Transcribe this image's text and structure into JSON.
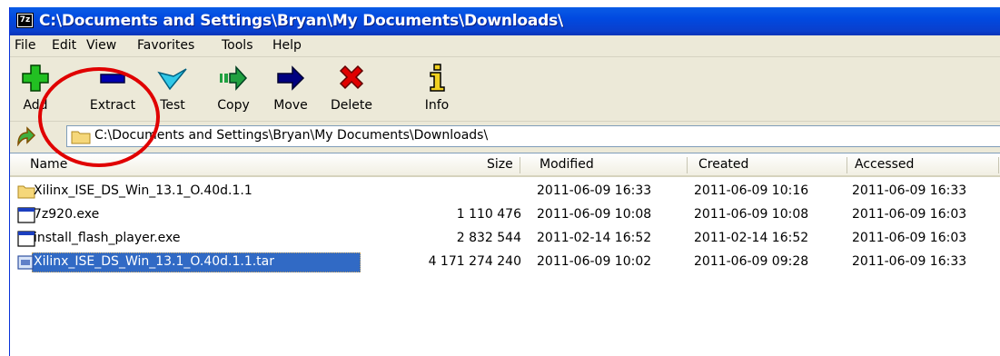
{
  "window": {
    "app_icon_text": "7z",
    "title": "C:\\Documents and Settings\\Bryan\\My Documents\\Downloads\\"
  },
  "menu": [
    "File",
    "Edit",
    "View",
    "Favorites",
    "Tools",
    "Help"
  ],
  "toolbar": {
    "buttons": [
      {
        "label": "Add",
        "icon": "add-icon",
        "color": "#22c022"
      },
      {
        "label": "Extract",
        "icon": "extract-icon",
        "color": "#0000b0"
      },
      {
        "label": "Test",
        "icon": "test-icon",
        "color": "#30c8e8"
      },
      {
        "label": "Copy",
        "icon": "copy-icon",
        "color": "#20a040"
      },
      {
        "label": "Move",
        "icon": "move-icon",
        "color": "#000080"
      },
      {
        "label": "Delete",
        "icon": "delete-icon",
        "color": "#e00000"
      },
      {
        "label": "Info",
        "icon": "info-icon",
        "color": "#c8a000"
      }
    ]
  },
  "address": {
    "path": "C:\\Documents and Settings\\Bryan\\My Documents\\Downloads\\"
  },
  "columns": {
    "name": "Name",
    "size": "Size",
    "modified": "Modified",
    "created": "Created",
    "accessed": "Accessed"
  },
  "files": [
    {
      "name": "Xilinx_ISE_DS_Win_13.1_O.40d.1.1",
      "type": "folder",
      "size": "",
      "modified": "2011-06-09 16:33",
      "created": "2011-06-09 10:16",
      "accessed": "2011-06-09 16:33"
    },
    {
      "name": "7z920.exe",
      "type": "exe",
      "size": "1 110 476",
      "modified": "2011-06-09 10:08",
      "created": "2011-06-09 10:08",
      "accessed": "2011-06-09 16:03"
    },
    {
      "name": "install_flash_player.exe",
      "type": "exe",
      "size": "2 832 544",
      "modified": "2011-02-14 16:52",
      "created": "2011-02-14 16:52",
      "accessed": "2011-06-09 16:03"
    },
    {
      "name": "Xilinx_ISE_DS_Win_13.1_O.40d.1.1.tar",
      "type": "archive",
      "size": "4 171 274 240",
      "modified": "2011-06-09 10:02",
      "created": "2011-06-09 09:28",
      "accessed": "2011-06-09 16:33",
      "selected": true
    }
  ],
  "colors": {
    "titlebar": "#0149e0",
    "selection": "#316ac5",
    "highlight_circle": "#e00000"
  }
}
